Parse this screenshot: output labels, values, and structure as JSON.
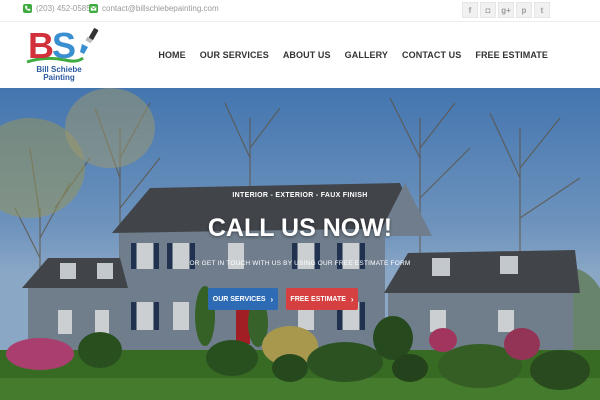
{
  "topbar": {
    "phone": "(203) 452-0585",
    "email": "contact@billschiebepainting.com",
    "socials": [
      {
        "icon": "facebook-icon",
        "glyph": "f"
      },
      {
        "icon": "instagram-icon",
        "glyph": "◘"
      },
      {
        "icon": "google-plus-icon",
        "glyph": "g+"
      },
      {
        "icon": "pinterest-icon",
        "glyph": "p"
      },
      {
        "icon": "twitter-icon",
        "glyph": "t"
      }
    ]
  },
  "logo": {
    "letters_b": "B",
    "letters_s": "S",
    "name_line1": "Bill Schiebe",
    "name_line2": "Painting"
  },
  "nav": {
    "items": [
      "HOME",
      "OUR SERVICES",
      "ABOUT US",
      "GALLERY",
      "CONTACT US",
      "FREE ESTIMATE"
    ]
  },
  "hero": {
    "eyebrow": "INTERIOR - EXTERIOR - FAUX FINISH",
    "headline": "CALL US NOW!",
    "subline": "OR GET IN TOUCH WITH US BY USING OUR FREE ESTIMATE FORM",
    "services_button": "OUR SERVICES",
    "estimate_button": "FREE ESTIMATE"
  },
  "colors": {
    "accent_green": "#3faa3f",
    "services_blue": "#2e6bb5",
    "estimate_red": "#d64041",
    "logo_red": "#d2303a",
    "logo_blue": "#3a8fd0"
  }
}
